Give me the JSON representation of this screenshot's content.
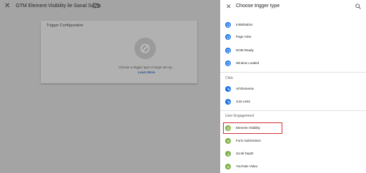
{
  "workspace": {
    "title": "GTM Element Visibility ile Sanal Sayfa",
    "icons": {
      "close": "close-icon",
      "folder": "folder-icon"
    },
    "config_card": {
      "title": "Trigger Configuration",
      "hint": "Choose a trigger type to begin set-up...",
      "learn_more": "Learn More"
    }
  },
  "panel": {
    "title": "Choose trigger type",
    "icons": {
      "close": "close-icon",
      "search": "search-icon"
    },
    "pageview_items": [
      {
        "label": "Initialisation",
        "color": "#1a73e8"
      },
      {
        "label": "Page View",
        "color": "#1a73e8"
      },
      {
        "label": "DOM Ready",
        "color": "#1a73e8"
      },
      {
        "label": "Window Loaded",
        "color": "#1a73e8"
      }
    ],
    "click_section": "Click",
    "click_items": [
      {
        "label": "All Elements",
        "color": "#1a73e8"
      },
      {
        "label": "Just Links",
        "color": "#1a73e8"
      }
    ],
    "engagement_section": "User Engagement",
    "engagement_items": [
      {
        "label": "Element Visibility",
        "color": "#7cb342",
        "highlighted": true
      },
      {
        "label": "Form Submission",
        "color": "#7cb342"
      },
      {
        "label": "Scroll Depth",
        "color": "#7cb342"
      },
      {
        "label": "YouTube Video",
        "color": "#7cb342"
      }
    ]
  },
  "colors": {
    "highlight_border": "#d32f2f",
    "blue_icon": "#1a73e8",
    "green_icon": "#7cb342"
  }
}
